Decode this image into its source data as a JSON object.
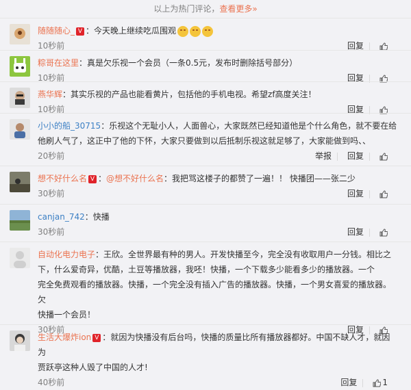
{
  "header": {
    "prefix": "以上为热门评论，",
    "more": "查看更多»"
  },
  "actions": {
    "reply": "回复",
    "report": "举报"
  },
  "comments": [
    {
      "user": "随随随心_",
      "separator": "：",
      "text": "今天晚上继续吃瓜围观",
      "time": "10秒前"
    },
    {
      "user": "粽哥在这里",
      "separator": "：",
      "text": "真是欠乐视一个会员（一条0.5元，发布时删除括号部分）",
      "time": "10秒前"
    },
    {
      "user": "燕华辉",
      "separator": "：",
      "text": "其实乐视的产品也能看黄片，包括他的手机电视。希望zf高度关注！",
      "time": "10秒前"
    },
    {
      "user": "小小的船_30715",
      "separator": "：",
      "text_line1": "乐视这个无耻小人，人面兽心，大家既然已经知道他是个什么角色，就不要在给",
      "text_line2": "他刷人气了，这正中了他的下怀，大家只要做到以后抵制乐视这就足够了，大家能做到吗、、",
      "time": "20秒前"
    },
    {
      "user": "想不好什么名",
      "separator": "：",
      "mention": "@想不好什么名",
      "text": "：我把骂这楼子的都赞了一遍！！ 快播团——张二少",
      "time": "30秒前"
    },
    {
      "user": "canjan_742",
      "separator": "：",
      "text": "快播",
      "time": "30秒前"
    },
    {
      "user": "自动化电力电子",
      "separator": "：",
      "text_line1": "王欣。全世界最有种的男人。开发快播至今，完全没有收取用户一分钱。相比之",
      "text_line2": "下，什么爱奇异，优酷，土豆等播放器，我呸！快播，一个下载多少能看多少的播放器。一个",
      "text_line3": "完全免费观看的播放器。快播，一个完全没有插入广告的播放器。快播，一个男女喜爱的播放器。欠",
      "text_line4": "快播一个会员！",
      "time": "30秒前"
    },
    {
      "user": "生活大爆炸ion",
      "separator": "：",
      "text_line1": "就因为快播没有后台吗，快播的质量比所有播放器都好。中国不缺人才，就因为",
      "text_line2": "贾跃亭这种人毁了中国的人才!",
      "time": "40秒前",
      "likes": "1"
    }
  ]
}
